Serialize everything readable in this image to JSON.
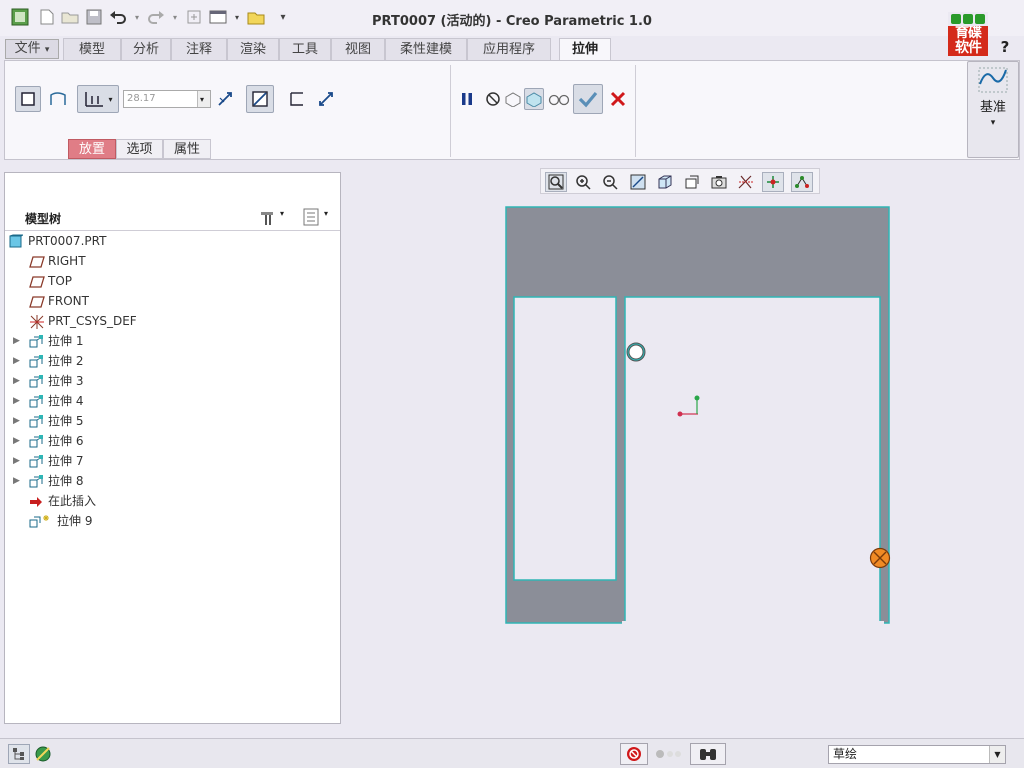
{
  "window": {
    "title": "PRT0007 (活动的) - Creo Parametric 1.0"
  },
  "brand": {
    "logo_text_1": "育碟",
    "logo_text_2": "软件",
    "help": "?"
  },
  "quick_access": [
    "new-icon",
    "open-icon",
    "save-icon",
    "undo-icon",
    "redo-icon",
    "regenerate-icon",
    "windows-icon",
    "close-window-icon",
    "customize-icon"
  ],
  "tabs": [
    {
      "label": "文件",
      "suffix": "▾"
    },
    {
      "label": "模型"
    },
    {
      "label": "分析"
    },
    {
      "label": "注释"
    },
    {
      "label": "渲染"
    },
    {
      "label": "工具"
    },
    {
      "label": "视图"
    },
    {
      "label": "柔性建模"
    },
    {
      "label": "应用程序"
    },
    {
      "label": "拉伸"
    }
  ],
  "ribbon": {
    "depth_value": "28.17",
    "subtabs": [
      "放置",
      "选项",
      "属性"
    ],
    "datum_label": "基准",
    "datum_arrow": "▾"
  },
  "model_tree": {
    "title": "模型树",
    "items": [
      {
        "label": "PRT0007.PRT",
        "icon": "part-icon"
      },
      {
        "label": "RIGHT",
        "icon": "datum-plane-icon"
      },
      {
        "label": "TOP",
        "icon": "datum-plane-icon"
      },
      {
        "label": "FRONT",
        "icon": "datum-plane-icon"
      },
      {
        "label": "PRT_CSYS_DEF",
        "icon": "csys-icon"
      },
      {
        "label": "拉伸 1",
        "icon": "extrude-icon",
        "expandable": "▶"
      },
      {
        "label": "拉伸 2",
        "icon": "extrude-icon",
        "expandable": "▶"
      },
      {
        "label": "拉伸 3",
        "icon": "extrude-icon",
        "expandable": "▶"
      },
      {
        "label": "拉伸 4",
        "icon": "extrude-icon",
        "expandable": "▶"
      },
      {
        "label": "拉伸 5",
        "icon": "extrude-icon",
        "expandable": "▶"
      },
      {
        "label": "拉伸 6",
        "icon": "extrude-icon",
        "expandable": "▶"
      },
      {
        "label": "拉伸 7",
        "icon": "extrude-icon",
        "expandable": "▶"
      },
      {
        "label": "拉伸 8",
        "icon": "extrude-icon",
        "expandable": "▶"
      },
      {
        "label": "在此插入",
        "icon": "insert-here-icon"
      },
      {
        "label": "拉伸 9",
        "icon": "new-extrude-icon"
      }
    ]
  },
  "status": {
    "filter_value": "草绘",
    "filter_arrow": "▼"
  },
  "colors": {
    "part_gray": "#8b8e98",
    "cyan_edge": "#2fb5b5",
    "background": "#ebe9f2",
    "active_subtab": "#e07d86",
    "drag_handle": "#f08a24"
  }
}
